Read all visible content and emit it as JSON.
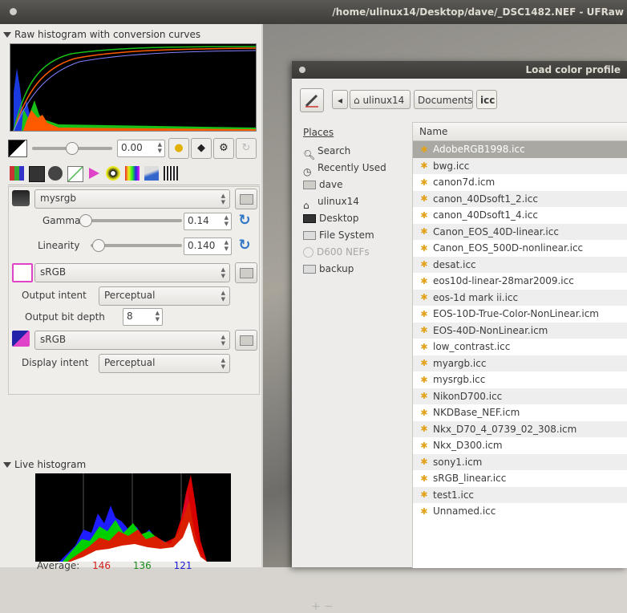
{
  "window": {
    "title": "/home/ulinux14/Desktop/dave/_DSC1482.NEF - UFRaw"
  },
  "left_panel": {
    "raw_histogram_title": "Raw histogram with conversion curves",
    "exposure_value": "0.00",
    "color_profiles": {
      "input_profile": "mysrgb",
      "gamma_label": "Gamma",
      "gamma_value": "0.14",
      "linearity_label": "Linearity",
      "linearity_value": "0.140",
      "output_profile": "sRGB",
      "output_intent_label": "Output intent",
      "output_intent_value": "Perceptual",
      "output_bit_depth_label": "Output bit depth",
      "output_bit_depth_value": "8",
      "display_profile": "sRGB",
      "display_intent_label": "Display intent",
      "display_intent_value": "Perceptual"
    },
    "live_histogram_title": "Live histogram",
    "average": {
      "label": "Average:",
      "r": "146",
      "g": "136",
      "b": "121"
    }
  },
  "dialog": {
    "title": "Load color profile",
    "path": [
      "ulinux14",
      "Documents",
      "icc"
    ],
    "places_header": "Places",
    "places": [
      {
        "label": "Search",
        "icon": "search-icon",
        "enabled": true
      },
      {
        "label": "Recently Used",
        "icon": "clock-icon",
        "enabled": true
      },
      {
        "label": "dave",
        "icon": "folder-icon",
        "enabled": true
      },
      {
        "label": "ulinux14",
        "icon": "home-icon",
        "enabled": true
      },
      {
        "label": "Desktop",
        "icon": "desktop-icon",
        "enabled": true
      },
      {
        "label": "File System",
        "icon": "drive-icon",
        "enabled": true
      },
      {
        "label": "D600 NEFs",
        "icon": "disc-icon",
        "enabled": false
      },
      {
        "label": "backup",
        "icon": "drive-icon",
        "enabled": true
      }
    ],
    "column_name": "Name",
    "files": [
      "AdobeRGB1998.icc",
      "bwg.icc",
      "canon7d.icm",
      "canon_40Dsoft1_2.icc",
      "canon_40Dsoft1_4.icc",
      "Canon_EOS_40D-linear.icc",
      "Canon_EOS_500D-nonlinear.icc",
      "desat.icc",
      "eos10d-linear-28mar2009.icc",
      "eos-1d mark ii.icc",
      "EOS-10D-True-Color-NonLinear.icm",
      "EOS-40D-NonLinear.icm",
      "low_contrast.icc",
      "myargb.icc",
      "mysrgb.icc",
      "NikonD700.icc",
      "NKDBase_NEF.icm",
      "Nkx_D70_4_0739_02_308.icm",
      "Nkx_D300.icm",
      "sony1.icm",
      "sRGB_linear.icc",
      "test1.icc",
      "Unnamed.icc"
    ],
    "selected_file": "AdobeRGB1998.icc",
    "add_remove": "+  −"
  },
  "colors": {
    "accent_blue": "#2f76c6",
    "avg_r": "#d42020",
    "avg_g": "#1a8c1a",
    "avg_b": "#2020d4",
    "file_icon": "#e2a21b"
  }
}
